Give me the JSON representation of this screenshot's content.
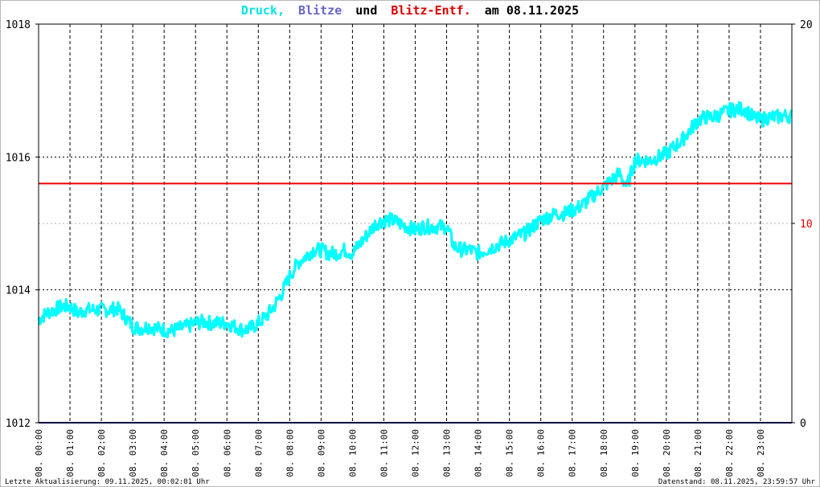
{
  "title": {
    "part1": "Druck,",
    "part2": "Blitze",
    "part3": "und",
    "part4": "Blitz-Entf.",
    "part5": "am 08.11.2025"
  },
  "colors": {
    "pressure": "#00ffff",
    "lightning_count": "#1a1a80",
    "lightning_distance": "#ee0000",
    "title_pressure": "#00e5e5",
    "title_lightning": "#6666cc",
    "title_distance": "#dd0000",
    "grid": "#000000",
    "left_axis_text": "#000000",
    "right_axis_text": "#000000",
    "right_axis_mid_text": "#dd0000"
  },
  "footer": {
    "left": "Letzte Aktualisierung: 09.11.2025, 00:02:01 Uhr",
    "right": "Datenstand: 08.11.2025, 23:59:57 Uhr"
  },
  "chart_data": {
    "type": "line",
    "title": "Druck, Blitze und Blitz-Entf. am 08.11.2025",
    "x_axis": {
      "ticks": [
        "08. 00:00",
        "08. 01:00",
        "08. 02:00",
        "08. 03:00",
        "08. 04:00",
        "08. 05:00",
        "08. 06:00",
        "08. 07:00",
        "08. 08:00",
        "08. 09:00",
        "08. 10:00",
        "08. 11:00",
        "08. 12:00",
        "08. 13:00",
        "08. 14:00",
        "08. 15:00",
        "08. 16:00",
        "08. 17:00",
        "08. 18:00",
        "08. 19:00",
        "08. 20:00",
        "08. 21:00",
        "08. 22:00",
        "08. 23:00"
      ],
      "range_hours": [
        0,
        24
      ]
    },
    "y_left": {
      "ticks": [
        "1012",
        "1014",
        "1016",
        "1018"
      ],
      "ylim": [
        1012,
        1018
      ]
    },
    "y_right": {
      "ticks": [
        "0",
        "10",
        "20"
      ],
      "ylim": [
        0,
        20
      ]
    },
    "grid": true,
    "series": [
      {
        "name": "Druck",
        "axis": "left",
        "x": [
          0,
          0.25,
          0.5,
          0.75,
          1,
          1.25,
          1.5,
          1.75,
          2,
          2.25,
          2.5,
          2.75,
          3,
          3.25,
          3.5,
          3.75,
          4,
          4.25,
          4.5,
          4.75,
          5,
          5.25,
          5.5,
          5.75,
          6,
          6.25,
          6.5,
          6.75,
          7,
          7.25,
          7.5,
          7.75,
          8,
          8.25,
          8.5,
          8.75,
          9,
          9.25,
          9.5,
          9.75,
          10,
          10.25,
          10.5,
          10.75,
          11,
          11.25,
          11.5,
          11.75,
          12,
          12.25,
          12.5,
          12.75,
          13,
          13.25,
          13.5,
          13.75,
          14,
          14.25,
          14.5,
          14.75,
          15,
          15.25,
          15.5,
          15.75,
          16,
          16.25,
          16.5,
          16.75,
          17,
          17.25,
          17.5,
          17.75,
          18,
          18.25,
          18.5,
          18.75,
          19,
          19.25,
          19.5,
          19.75,
          20,
          20.25,
          20.5,
          20.75,
          21,
          21.25,
          21.5,
          21.75,
          22,
          22.25,
          22.5,
          22.75,
          23,
          23.25,
          23.5,
          23.75,
          24
        ],
        "values": [
          1013.55,
          1013.65,
          1013.7,
          1013.75,
          1013.75,
          1013.65,
          1013.7,
          1013.7,
          1013.7,
          1013.7,
          1013.72,
          1013.6,
          1013.45,
          1013.42,
          1013.45,
          1013.42,
          1013.4,
          1013.38,
          1013.42,
          1013.45,
          1013.5,
          1013.52,
          1013.5,
          1013.5,
          1013.5,
          1013.45,
          1013.4,
          1013.42,
          1013.5,
          1013.6,
          1013.75,
          1013.95,
          1014.2,
          1014.4,
          1014.5,
          1014.6,
          1014.6,
          1014.55,
          1014.55,
          1014.6,
          1014.55,
          1014.7,
          1014.85,
          1015.0,
          1015.05,
          1015.05,
          1015.0,
          1014.95,
          1014.9,
          1014.95,
          1014.95,
          1014.95,
          1014.95,
          1014.65,
          1014.6,
          1014.6,
          1014.55,
          1014.6,
          1014.65,
          1014.7,
          1014.75,
          1014.8,
          1014.85,
          1014.95,
          1015.05,
          1015.1,
          1015.15,
          1015.15,
          1015.2,
          1015.25,
          1015.35,
          1015.45,
          1015.55,
          1015.65,
          1015.75,
          1015.55,
          1015.95,
          1015.95,
          1015.95,
          1016.0,
          1016.05,
          1016.15,
          1016.25,
          1016.4,
          1016.55,
          1016.6,
          1016.6,
          1016.65,
          1016.7,
          1016.72,
          1016.72,
          1016.6,
          1016.55,
          1016.6,
          1016.6,
          1016.62,
          1016.62
        ]
      },
      {
        "name": "Blitz-Entf.",
        "axis": "right",
        "x": [
          0,
          24
        ],
        "values": [
          12,
          12
        ]
      },
      {
        "name": "Blitze",
        "axis": "right",
        "x": [
          0,
          24
        ],
        "values": [
          0,
          0
        ]
      }
    ]
  }
}
